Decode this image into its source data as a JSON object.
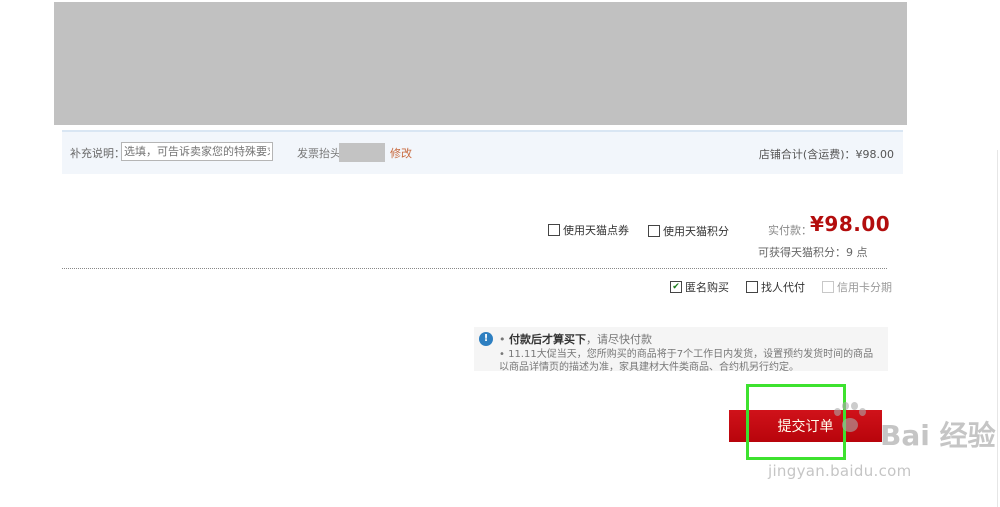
{
  "memo": {
    "label": "补充说明：",
    "placeholder": "选填，可告诉卖家您的特殊要求",
    "invoice_label": "发票抬头",
    "invoice_edit": "修改",
    "store_total": "店铺合计(含运费)：¥98.00"
  },
  "options": {
    "coupon_label": "使用天猫点券",
    "points_label": "使用天猫积分"
  },
  "payment": {
    "label": "实付款：",
    "amount": "¥98.00",
    "points_earned": "可获得天猫积分：9 点"
  },
  "pay_options": {
    "anonymous": {
      "label": "匿名购买",
      "checked": true
    },
    "proxy": {
      "label": "找人代付",
      "checked": false
    },
    "installment": {
      "label": "信用卡分期",
      "disabled": true
    }
  },
  "notice": {
    "icon": "info-icon",
    "title": "付款后才算买下",
    "title_suffix": "，请尽快付款",
    "bullet_1": "11.11大促当天，您所购买的商品将于7个工作日内发货，设置预约发货时间的商品",
    "bullet_2": "以商品详情页的描述为准，家具建材大件类商品、合约机另行约定。"
  },
  "submit": {
    "label": "提交订单"
  },
  "watermark": {
    "text": "Bai 经验",
    "url": "jingyan.baidu.com"
  },
  "colors": {
    "accent_red": "#c5050d",
    "highlight_green": "#3de22f",
    "notice_blue": "#2d7fc1"
  }
}
